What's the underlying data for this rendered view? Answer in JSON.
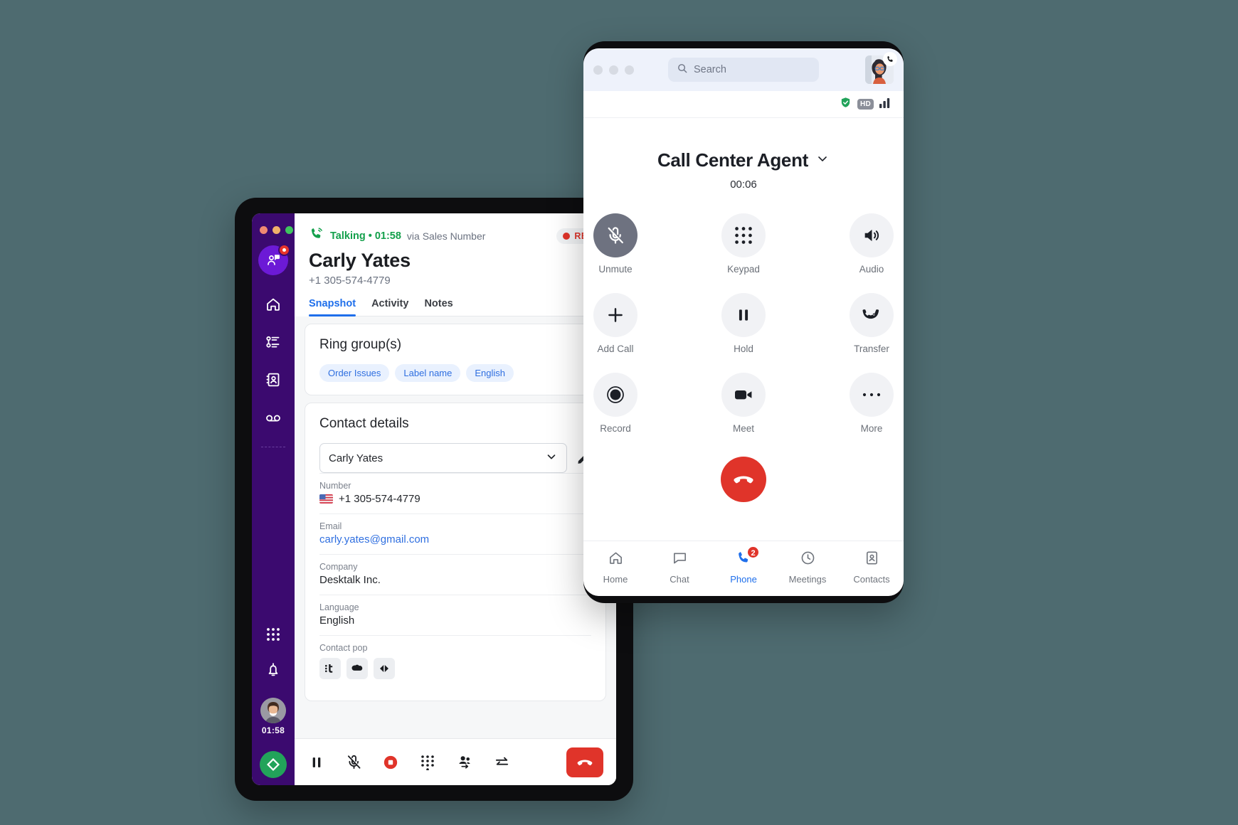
{
  "desktop": {
    "window_controls": [
      "close",
      "minimize",
      "maximize"
    ],
    "sidebar": {
      "avatar_badge_icon": "contact-assist-icon",
      "items": [
        {
          "icon": "home-icon",
          "name": "home"
        },
        {
          "icon": "activity-list-icon",
          "name": "activity"
        },
        {
          "icon": "contacts-book-icon",
          "name": "contacts"
        },
        {
          "icon": "voicemail-icon",
          "name": "voicemail"
        }
      ],
      "lower_items": [
        {
          "icon": "dialpad-icon",
          "name": "dialpad"
        },
        {
          "icon": "bell-icon",
          "name": "notifications"
        }
      ],
      "me_timer": "01:58",
      "status_icon": "availability-diamond-icon"
    },
    "call_header": {
      "status_label": "Talking • 01:58",
      "via_label": "via Sales Number",
      "rec_label": "REC",
      "contact_name": "Carly Yates",
      "contact_number": "+1 305-574-4779"
    },
    "tabs": [
      {
        "label": "Snapshot",
        "active": true
      },
      {
        "label": "Activity",
        "active": false
      },
      {
        "label": "Notes",
        "active": false
      }
    ],
    "ring_groups": {
      "title": "Ring group(s)",
      "chips": [
        "Order Issues",
        "Label name",
        "English"
      ]
    },
    "contact_details": {
      "title": "Contact details",
      "selected_contact": "Carly Yates",
      "edit_icon": "pencil-icon",
      "fields": [
        {
          "label": "Number",
          "value": "+1 305-574-4779",
          "flag": "us-flag",
          "type": "phone"
        },
        {
          "label": "Email",
          "value": "carly.yates@gmail.com",
          "type": "link"
        },
        {
          "label": "Company",
          "value": "Desktalk Inc.",
          "type": "text"
        },
        {
          "label": "Language",
          "value": "English",
          "type": "text"
        },
        {
          "label": "Contact pop",
          "type": "apps",
          "apps": [
            "teamleader-icon",
            "salesforce-icon",
            "zendesk-icon"
          ]
        }
      ]
    },
    "footer_actions": [
      {
        "icon": "pause-icon",
        "name": "hold"
      },
      {
        "icon": "mic-off-icon",
        "name": "mute"
      },
      {
        "icon": "record-stop-icon",
        "name": "record"
      },
      {
        "icon": "dialpad-icon",
        "name": "keypad"
      },
      {
        "icon": "add-participant-icon",
        "name": "add-participant"
      },
      {
        "icon": "transfer-arrows-icon",
        "name": "transfer"
      },
      {
        "icon": "end-call-icon",
        "name": "end-call"
      }
    ]
  },
  "phone": {
    "titlebar": {
      "search_placeholder": "Search",
      "search_icon": "search-icon",
      "avatar_icon": "user-avatar",
      "call_badge_icon": "phone-icon"
    },
    "status_icons": [
      {
        "icon": "shield-check-icon",
        "name": "encrypted"
      },
      {
        "icon": "hd-badge",
        "label": "HD"
      },
      {
        "icon": "signal-bars-icon",
        "name": "signal"
      }
    ],
    "call": {
      "callee": "Call Center Agent",
      "chevron_icon": "chevron-down-icon",
      "duration": "00:06"
    },
    "controls": [
      {
        "label": "Unmute",
        "icon": "mic-off-icon",
        "state": "muted"
      },
      {
        "label": "Keypad",
        "icon": "dialpad-icon",
        "state": "default"
      },
      {
        "label": "Audio",
        "icon": "speaker-icon",
        "state": "default"
      },
      {
        "label": "Add Call",
        "icon": "plus-icon",
        "state": "default"
      },
      {
        "label": "Hold",
        "icon": "pause-icon",
        "state": "default"
      },
      {
        "label": "Transfer",
        "icon": "transfer-call-icon",
        "state": "default"
      },
      {
        "label": "Record",
        "icon": "record-icon",
        "state": "default"
      },
      {
        "label": "Meet",
        "icon": "video-camera-icon",
        "state": "default"
      },
      {
        "label": "More",
        "icon": "ellipsis-icon",
        "state": "default"
      }
    ],
    "end_call": {
      "icon": "end-call-icon",
      "color": "#e0342a"
    },
    "tabbar": [
      {
        "label": "Home",
        "icon": "home-icon",
        "active": false,
        "badge": null
      },
      {
        "label": "Chat",
        "icon": "chat-bubble-icon",
        "active": false,
        "badge": null
      },
      {
        "label": "Phone",
        "icon": "phone-icon",
        "active": true,
        "badge": "2"
      },
      {
        "label": "Meetings",
        "icon": "clock-icon",
        "active": false,
        "badge": null
      },
      {
        "label": "Contacts",
        "icon": "contact-card-icon",
        "active": false,
        "badge": null
      }
    ]
  },
  "colors": {
    "background": "#4e6b70",
    "sidebar_purple": "#3b0a6f",
    "accent_blue": "#1f6feb",
    "danger_red": "#e0342a",
    "green": "#14a04c"
  }
}
